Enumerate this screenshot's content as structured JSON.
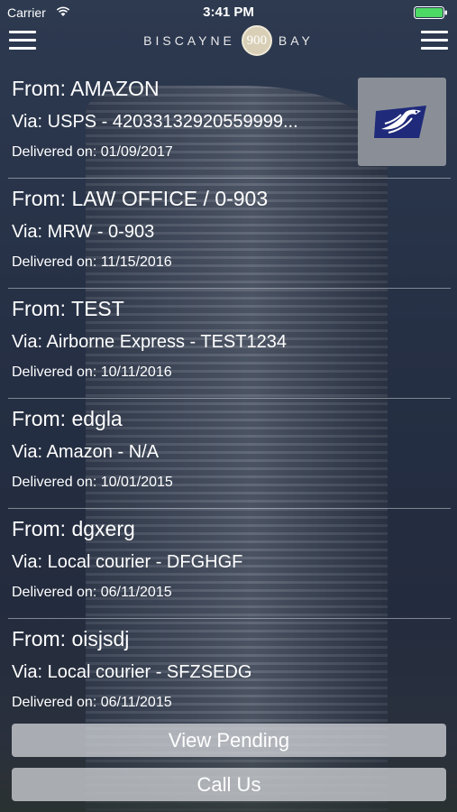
{
  "status_bar": {
    "carrier": "Carrier",
    "time": "3:41 PM"
  },
  "brand": {
    "left_word": "BISCAYNE",
    "badge": "900",
    "right_word": "BAY"
  },
  "packages": [
    {
      "from": "From: AMAZON",
      "via": "Via: USPS - 42033132920559999...",
      "delivered": "Delivered on: 01/09/2017",
      "carrier_icon": "usps-eagle-icon"
    },
    {
      "from": "From: LAW OFFICE / 0-903",
      "via": "Via: MRW - 0-903",
      "delivered": "Delivered on: 11/15/2016"
    },
    {
      "from": "From: TEST",
      "via": "Via: Airborne Express - TEST1234",
      "delivered": "Delivered on: 10/11/2016"
    },
    {
      "from": "From: edgla",
      "via": "Via: Amazon - N/A",
      "delivered": "Delivered on: 10/01/2015"
    },
    {
      "from": "From: dgxerg",
      "via": "Via: Local courier - DFGHGF",
      "delivered": "Delivered on: 06/11/2015"
    },
    {
      "from": "From: oisjsdj",
      "via": "Via: Local courier - SFZSEDG",
      "delivered": "Delivered on: 06/11/2015"
    }
  ],
  "buttons": {
    "view_pending": "View Pending",
    "call_us": "Call Us"
  },
  "colors": {
    "badge": "#d8cfb6",
    "usps_blue": "#1f2a7a",
    "battery": "#4cd964"
  }
}
